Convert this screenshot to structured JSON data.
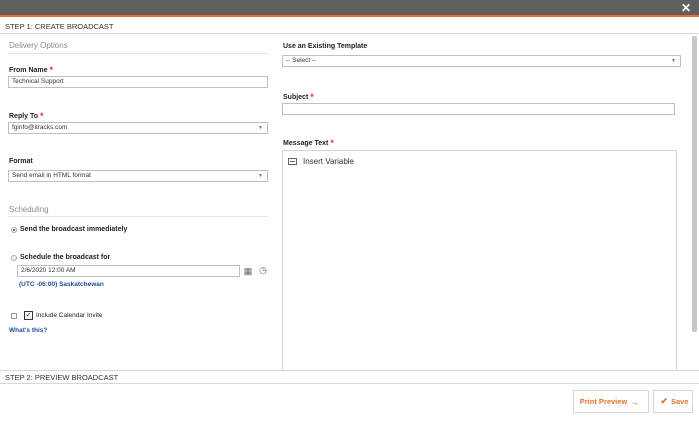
{
  "window": {
    "close_glyph": "✕"
  },
  "steps": {
    "step1": "STEP 1: CREATE BROADCAST",
    "step2": "STEP 2: PREVIEW BROADCAST"
  },
  "delivery": {
    "section_title": "Delivery Options",
    "from_name_label": "From Name",
    "from_name_value": "Technical Support",
    "reply_to_label": "Reply To",
    "reply_to_value": "fginfo@itracks.com",
    "format_label": "Format",
    "format_value": "Send email in HTML format"
  },
  "scheduling": {
    "section_title": "Scheduling",
    "send_now_label": "Send the broadcast immediately",
    "send_now_selected": true,
    "schedule_label": "Schedule the broadcast for",
    "schedule_value": "2/6/2020 12:00 AM",
    "timezone": "(UTC -06:00) Saskatchewan",
    "calendar_invite_label": "Include Calendar Invite",
    "calendar_invite_checked": false,
    "whats_this": "What's this?"
  },
  "template": {
    "label": "Use an Existing Template",
    "value": "-- Select --"
  },
  "subject": {
    "label": "Subject",
    "value": ""
  },
  "message": {
    "label": "Message Text",
    "insert_variable": "Insert Variable"
  },
  "footer": {
    "print_preview": "Print Preview",
    "print_preview_icon": "→",
    "save": "Save",
    "save_icon": "✔"
  },
  "colors": {
    "accent": "#e8702a",
    "link": "#1f4e9a",
    "required": "#e0342b",
    "titlebar": "#5f5f5f"
  }
}
